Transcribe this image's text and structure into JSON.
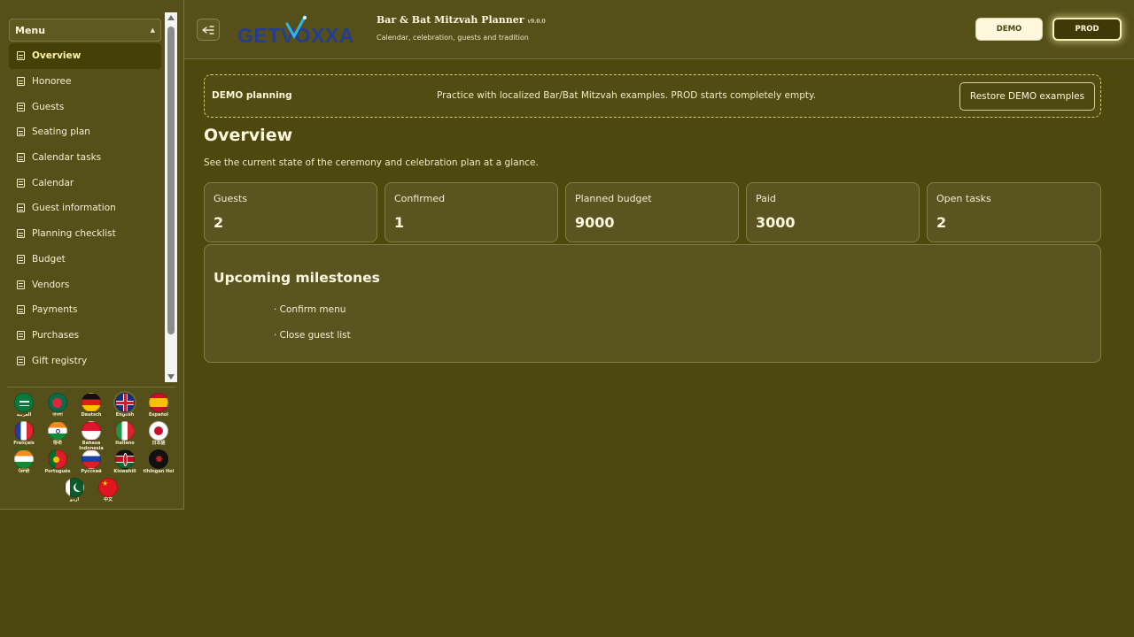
{
  "menu": {
    "title": "Menu",
    "items": [
      {
        "label": "Overview",
        "active": true
      },
      {
        "label": "Honoree"
      },
      {
        "label": "Guests"
      },
      {
        "label": "Seating plan"
      },
      {
        "label": "Calendar tasks"
      },
      {
        "label": "Calendar"
      },
      {
        "label": "Guest information"
      },
      {
        "label": "Planning checklist"
      },
      {
        "label": "Budget"
      },
      {
        "label": "Vendors"
      },
      {
        "label": "Payments"
      },
      {
        "label": "Purchases"
      },
      {
        "label": "Gift registry"
      }
    ]
  },
  "languages": [
    {
      "label": "العربية",
      "flag": "sa-flag-icon"
    },
    {
      "label": "বাংলা",
      "flag": "bd-flag-icon"
    },
    {
      "label": "Deutsch",
      "flag": "de-flag-icon"
    },
    {
      "label": "English",
      "flag": "gb-flag-icon",
      "selected": true
    },
    {
      "label": "Español",
      "flag": "es-flag-icon"
    },
    {
      "label": "Français",
      "flag": "fr-flag-icon"
    },
    {
      "label": "हिन्दी",
      "flag": "in-flag-icon"
    },
    {
      "label": "Bahasa Indonesia",
      "flag": "id-flag-icon"
    },
    {
      "label": "Italiano",
      "flag": "it-flag-icon"
    },
    {
      "label": "日本語",
      "flag": "jp-flag-icon"
    },
    {
      "label": "ਪੰਜਾਬੀ",
      "flag": "in-flag-icon"
    },
    {
      "label": "Português",
      "flag": "pt-flag-icon"
    },
    {
      "label": "Русский",
      "flag": "ru-flag-icon"
    },
    {
      "label": "Kiswahili",
      "flag": "ke-flag-icon"
    },
    {
      "label": "tlhIngan Hol",
      "flag": "klingon-flag-icon"
    },
    {
      "label": "اردو",
      "flag": "pk-flag-icon"
    },
    {
      "label": "中文",
      "flag": "cn-flag-icon"
    }
  ],
  "header": {
    "logo_text": "GETVOXXA",
    "title": "Bar & Bat Mitzvah Planner",
    "version": "v9.0.0",
    "subtitle": "Calendar, celebration, guests and tradition",
    "demo_label": "DEMO",
    "prod_label": "PROD",
    "active_env": "PROD"
  },
  "banner": {
    "title": "DEMO planning",
    "message": "Practice with localized Bar/Bat Mitzvah examples. PROD starts completely empty.",
    "restore_label": "Restore DEMO examples"
  },
  "overview": {
    "title": "Overview",
    "description": "See the current state of the ceremony and celebration plan at a glance.",
    "stats": [
      {
        "label": "Guests",
        "value": "2"
      },
      {
        "label": "Confirmed",
        "value": "1"
      },
      {
        "label": "Planned budget",
        "value": "9000"
      },
      {
        "label": "Paid",
        "value": "3000"
      },
      {
        "label": "Open tasks",
        "value": "2"
      }
    ],
    "milestones_title": "Upcoming milestones",
    "milestones": [
      "· Confirm menu",
      "· Close guest list"
    ]
  },
  "colors": {
    "background": "#4d480d",
    "panel": "#55501a",
    "card": "#5a5520",
    "accent": "#fff4a8",
    "demo_button": "#fdf8de",
    "prod_button": "#3d3a08"
  }
}
